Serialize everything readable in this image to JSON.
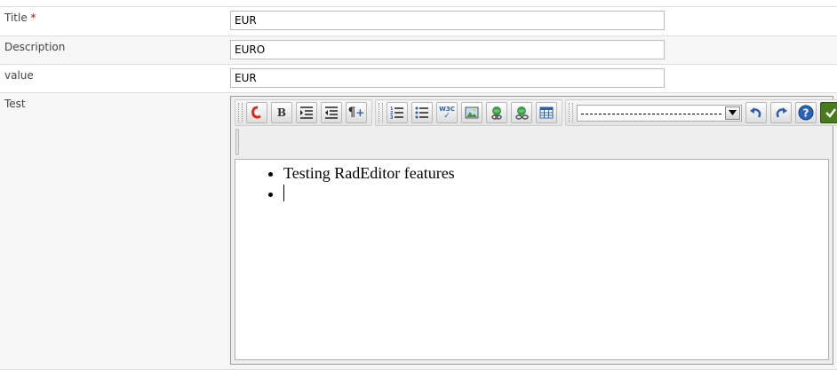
{
  "form": {
    "fields": [
      {
        "label": "Title",
        "required_mark": "*",
        "value": "EUR"
      },
      {
        "label": "Description",
        "value": "EURO"
      },
      {
        "label": "value",
        "value": "EUR"
      }
    ],
    "test_label": "Test"
  },
  "editor": {
    "toolbar": {
      "buttons": [
        {
          "name": "spellcheck-icon"
        },
        {
          "name": "bold-button",
          "label": "B"
        },
        {
          "name": "indent-icon"
        },
        {
          "name": "outdent-icon"
        },
        {
          "name": "paragraph-insert-icon",
          "label": "¶"
        },
        {
          "name": "ordered-list-icon"
        },
        {
          "name": "unordered-list-icon"
        },
        {
          "name": "w3c-validate-icon",
          "label": "W3C"
        },
        {
          "name": "image-manager-icon"
        },
        {
          "name": "link-manager-icon"
        },
        {
          "name": "unlink-icon"
        },
        {
          "name": "table-icon"
        },
        {
          "name": "undo-icon"
        },
        {
          "name": "redo-icon"
        },
        {
          "name": "help-icon"
        },
        {
          "name": "save-check-icon"
        }
      ],
      "select_value": "----------------------------------------"
    },
    "content": {
      "list_items": [
        "Testing RadEditor features",
        ""
      ]
    }
  },
  "colors": {
    "required": "#d40000",
    "check_button": "#4a7a1e",
    "help_button": "#2a63b8",
    "undo_redo": "#2b5fae"
  }
}
